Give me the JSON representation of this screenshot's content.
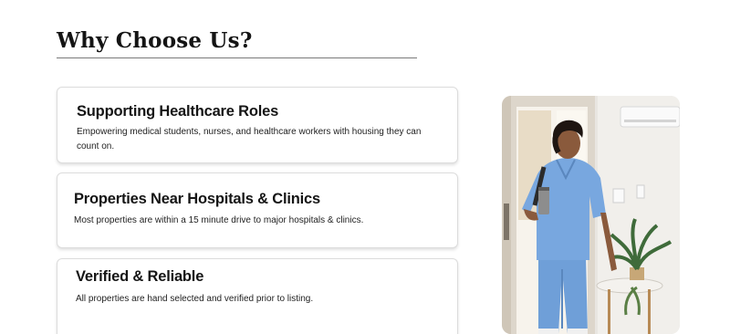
{
  "section": {
    "title": "Why Choose Us?"
  },
  "features": [
    {
      "title": "Supporting Healthcare Roles",
      "description": "Empowering medical students, nurses, and healthcare workers with housing they can count on."
    },
    {
      "title": "Properties Near Hospitals & Clinics",
      "description": "Most properties are within a 15 minute drive to major hospitals & clinics."
    },
    {
      "title": "Verified & Reliable",
      "description": "All properties are hand selected and verified prior to listing."
    }
  ],
  "image": {
    "subject": "nurse-in-scrubs-photo"
  },
  "colors": {
    "scrubs": "#6f9fd8",
    "text": "#141414",
    "card_border": "#dcdcdc"
  }
}
